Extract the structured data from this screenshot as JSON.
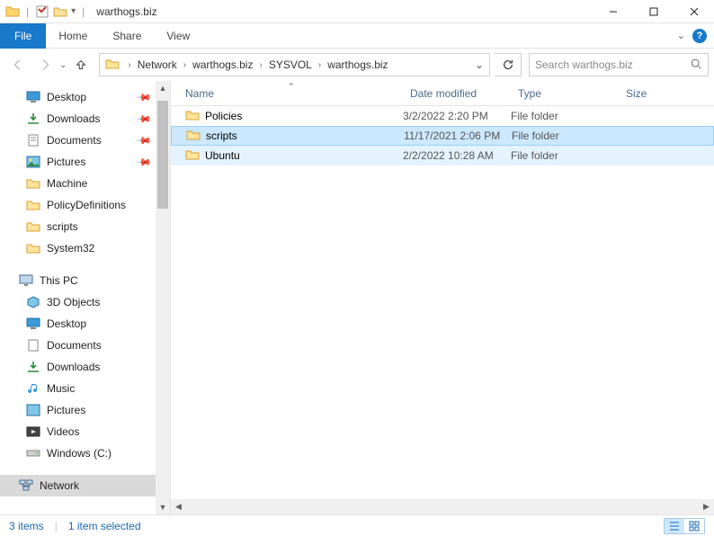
{
  "window_title": "warthogs.biz",
  "ribbon": {
    "file": "File",
    "tabs": [
      "Home",
      "Share",
      "View"
    ]
  },
  "breadcrumb": [
    "Network",
    "warthogs.biz",
    "SYSVOL",
    "warthogs.biz"
  ],
  "search": {
    "placeholder": "Search warthogs.biz"
  },
  "columns": {
    "name": "Name",
    "date": "Date modified",
    "type": "Type",
    "size": "Size"
  },
  "files": [
    {
      "name": "Policies",
      "date": "3/2/2022 2:20 PM",
      "type": "File folder",
      "state": ""
    },
    {
      "name": "scripts",
      "date": "11/17/2021 2:06 PM",
      "type": "File folder",
      "state": "selected"
    },
    {
      "name": "Ubuntu",
      "date": "2/2/2022 10:28 AM",
      "type": "File folder",
      "state": "hover"
    }
  ],
  "tree_quick": [
    {
      "label": "Desktop",
      "icon": "desktop",
      "pinned": true
    },
    {
      "label": "Downloads",
      "icon": "download",
      "pinned": true
    },
    {
      "label": "Documents",
      "icon": "document",
      "pinned": true
    },
    {
      "label": "Pictures",
      "icon": "picture",
      "pinned": true
    },
    {
      "label": "Machine",
      "icon": "folder"
    },
    {
      "label": "PolicyDefinitions",
      "icon": "folder"
    },
    {
      "label": "scripts",
      "icon": "folder"
    },
    {
      "label": "System32",
      "icon": "folder"
    }
  ],
  "tree_thispc": {
    "label": "This PC",
    "children": [
      {
        "label": "3D Objects",
        "icon": "3d"
      },
      {
        "label": "Desktop",
        "icon": "desktop"
      },
      {
        "label": "Documents",
        "icon": "document"
      },
      {
        "label": "Downloads",
        "icon": "download"
      },
      {
        "label": "Music",
        "icon": "music"
      },
      {
        "label": "Pictures",
        "icon": "picture"
      },
      {
        "label": "Videos",
        "icon": "video"
      },
      {
        "label": "Windows (C:)",
        "icon": "drive"
      }
    ]
  },
  "tree_network": {
    "label": "Network"
  },
  "status": {
    "items": "3 items",
    "selected": "1 item selected"
  }
}
